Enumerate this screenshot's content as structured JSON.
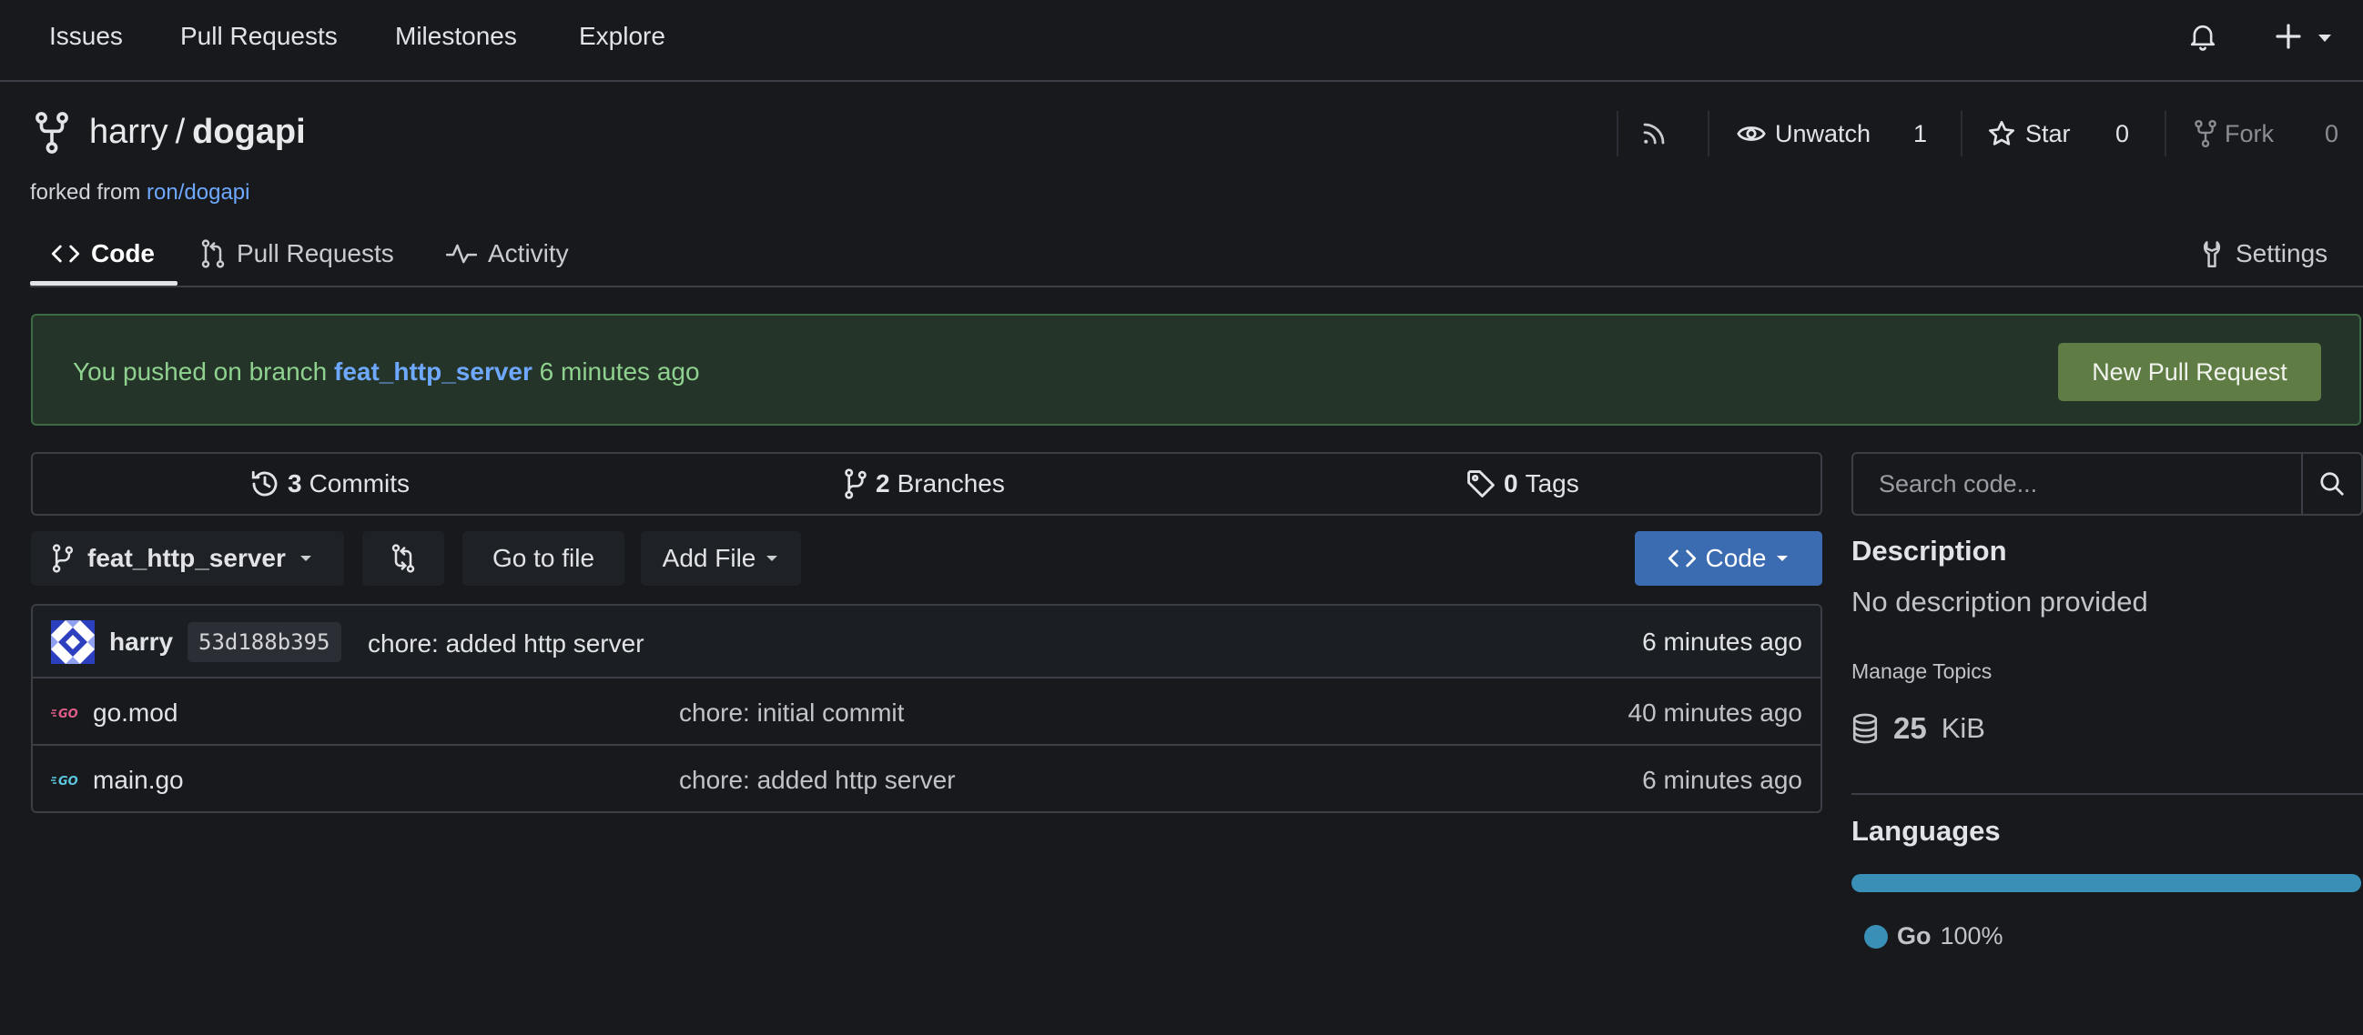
{
  "topnav": {
    "items": [
      "Issues",
      "Pull Requests",
      "Milestones",
      "Explore"
    ]
  },
  "repo": {
    "owner": "harry",
    "separator": "/",
    "name": "dogapi",
    "forked_prefix": "forked from",
    "forked_from": "ron/dogapi"
  },
  "header_actions": {
    "unwatch_label": "Unwatch",
    "unwatch_count": "1",
    "star_label": "Star",
    "star_count": "0",
    "fork_label": "Fork",
    "fork_count": "0"
  },
  "tabs": {
    "code": "Code",
    "pull_requests": "Pull Requests",
    "activity": "Activity",
    "settings": "Settings"
  },
  "banner": {
    "prefix": "You pushed on branch",
    "branch": "feat_http_server",
    "suffix": "6 minutes ago",
    "button": "New Pull Request"
  },
  "stats": {
    "commits_count": "3",
    "commits_label": "Commits",
    "branches_count": "2",
    "branches_label": "Branches",
    "tags_count": "0",
    "tags_label": "Tags"
  },
  "toolbar": {
    "branch": "feat_http_server",
    "go_to_file": "Go to file",
    "add_file": "Add File",
    "code": "Code"
  },
  "latest_commit": {
    "author": "harry",
    "sha": "53d188b395",
    "message": "chore: added http server",
    "time": "6 minutes ago"
  },
  "files": [
    {
      "name": "go.mod",
      "message": "chore: initial commit",
      "time": "40 minutes ago",
      "icon": "go-file-icon"
    },
    {
      "name": "main.go",
      "message": "chore: added http server",
      "time": "6 minutes ago",
      "icon": "go-file-icon"
    }
  ],
  "sidebar": {
    "search_placeholder": "Search code...",
    "description_title": "Description",
    "description": "No description provided",
    "manage_topics": "Manage Topics",
    "size_value": "25",
    "size_unit": "KiB",
    "languages_title": "Languages",
    "language_name": "Go",
    "language_percent": "100%",
    "language_fraction": 1.0,
    "language_color": "#3a8fb7"
  },
  "colors": {
    "background": "#17191d",
    "accent_blue": "#3b6bb0",
    "banner_bg": "#253428",
    "banner_text": "#8fd18f",
    "link": "#6ea8ff",
    "new_pr_button": "#5e7c44"
  }
}
